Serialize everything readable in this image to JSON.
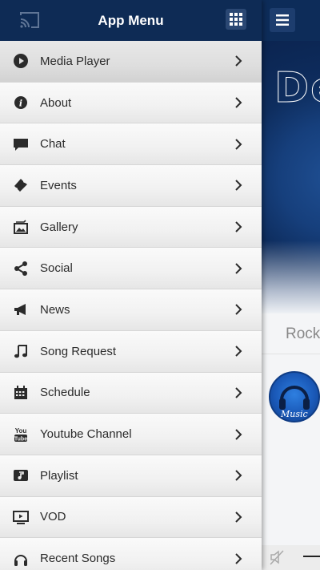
{
  "drawer": {
    "title": "App Menu",
    "items": [
      {
        "label": "Media Player",
        "icon": "play-circle-icon",
        "active": true
      },
      {
        "label": "About",
        "icon": "info-icon"
      },
      {
        "label": "Chat",
        "icon": "chat-bubble-icon"
      },
      {
        "label": "Events",
        "icon": "ticket-icon"
      },
      {
        "label": "Gallery",
        "icon": "gallery-icon"
      },
      {
        "label": "Social",
        "icon": "share-icon"
      },
      {
        "label": "News",
        "icon": "megaphone-icon"
      },
      {
        "label": "Song Request",
        "icon": "music-note-icon"
      },
      {
        "label": "Schedule",
        "icon": "calendar-icon"
      },
      {
        "label": "Youtube Channel",
        "icon": "youtube-icon"
      },
      {
        "label": "Playlist",
        "icon": "playlist-icon"
      },
      {
        "label": "VOD",
        "icon": "tv-icon"
      },
      {
        "label": "Recent Songs",
        "icon": "headphones-icon"
      }
    ]
  },
  "background": {
    "banner_text": "De",
    "genre": "Rock",
    "music_logo_text": "Music"
  },
  "colors": {
    "header": "#0e2b55",
    "accent": "#1a59b8",
    "menu_text": "#2b2b2b"
  }
}
